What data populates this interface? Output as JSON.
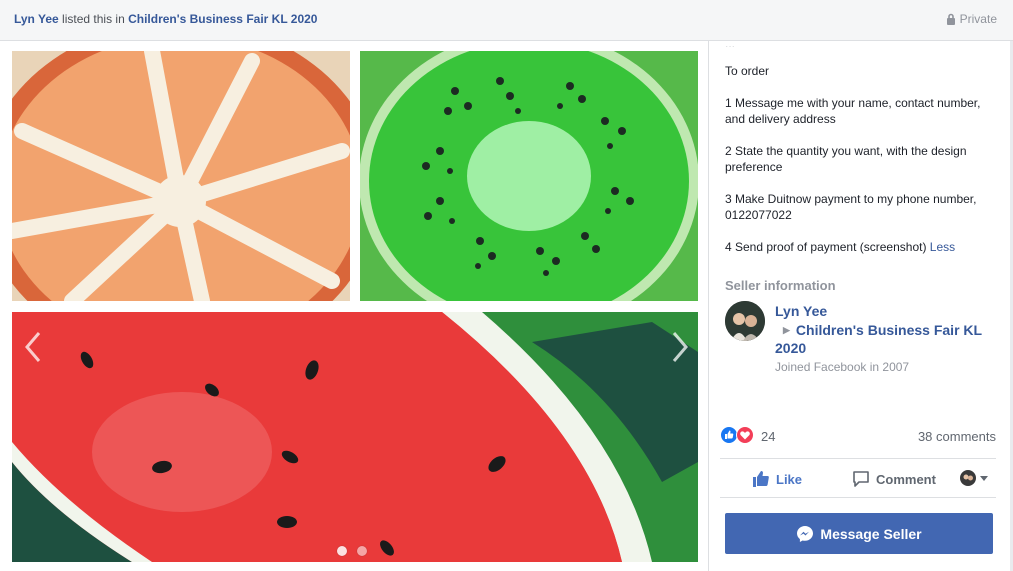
{
  "header": {
    "seller": "Lyn Yee",
    "listed_text": "listed this in",
    "group": "Children's Business Fair KL 2020",
    "privacy": "Private"
  },
  "photos": {
    "tiles": [
      {
        "name": "orange-slice-painting"
      },
      {
        "name": "kiwi-slice-painting"
      },
      {
        "name": "watermelon-slice-painting"
      }
    ],
    "dots_count": 2
  },
  "description": {
    "truncated_line": "...",
    "to_order": "To order",
    "step1": "1 Message me with your name, contact number, and delivery address",
    "step2": "2 State the quantity you want, with the design preference",
    "step3": "3 Make Duitnow payment to my phone number, 0122077022",
    "step4": "4 Send proof of payment (screenshot)",
    "less_link": "Less"
  },
  "seller_info": {
    "title": "Seller information",
    "name": "Lyn Yee",
    "group": "Children's Business Fair KL 2020",
    "joined": "Joined Facebook in 2007"
  },
  "engagement": {
    "reaction_count": "24",
    "comments": "38 comments"
  },
  "actions": {
    "like": "Like",
    "comment": "Comment"
  },
  "message_button": "Message Seller",
  "colors": {
    "brand_blue": "#4267b2",
    "link_blue": "#365899",
    "like_blue": "#1877f2",
    "love_red": "#f33e58"
  }
}
